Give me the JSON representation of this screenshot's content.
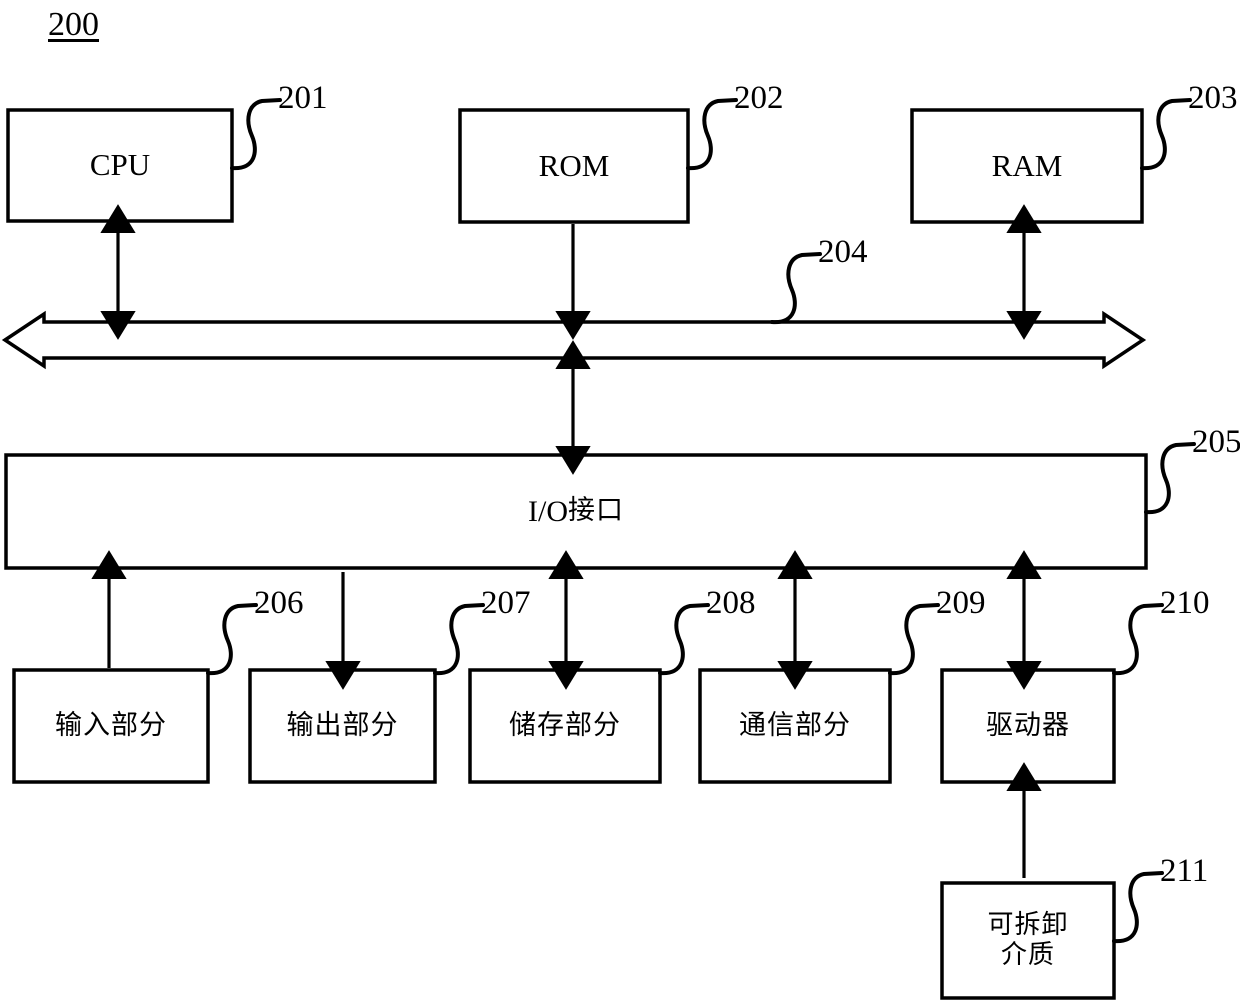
{
  "figure": {
    "number": "200",
    "blocks": [
      {
        "id": "cpu",
        "label": "CPU",
        "ref": "201"
      },
      {
        "id": "rom",
        "label": "ROM",
        "ref": "202"
      },
      {
        "id": "ram",
        "label": "RAM",
        "ref": "203"
      },
      {
        "id": "bus",
        "label": "",
        "ref": "204"
      },
      {
        "id": "io-interface",
        "label": "I/O接口",
        "ref": "205"
      },
      {
        "id": "input-part",
        "label": "输入部分",
        "ref": "206"
      },
      {
        "id": "output-part",
        "label": "输出部分",
        "ref": "207"
      },
      {
        "id": "storage-part",
        "label": "储存部分",
        "ref": "208"
      },
      {
        "id": "comm-part",
        "label": "通信部分",
        "ref": "209"
      },
      {
        "id": "driver",
        "label": "驱动器",
        "ref": "210"
      },
      {
        "id": "removable",
        "label": "可拆卸\n介质",
        "ref": "211"
      }
    ],
    "io_label_latin": "I/O",
    "io_label_cjk": "接口",
    "connections": [
      {
        "from": "cpu",
        "to": "bus",
        "direction": "bidirectional"
      },
      {
        "from": "rom",
        "to": "bus",
        "direction": "down"
      },
      {
        "from": "ram",
        "to": "bus",
        "direction": "bidirectional"
      },
      {
        "from": "bus",
        "to": "io-interface",
        "direction": "bidirectional"
      },
      {
        "from": "io-interface",
        "to": "input-part",
        "direction": "up"
      },
      {
        "from": "io-interface",
        "to": "output-part",
        "direction": "down"
      },
      {
        "from": "io-interface",
        "to": "storage-part",
        "direction": "bidirectional"
      },
      {
        "from": "io-interface",
        "to": "comm-part",
        "direction": "bidirectional"
      },
      {
        "from": "io-interface",
        "to": "driver",
        "direction": "bidirectional"
      },
      {
        "from": "removable",
        "to": "driver",
        "direction": "up"
      }
    ],
    "colors": {
      "stroke": "#000000",
      "fill": "#ffffff",
      "background": "#ffffff"
    }
  }
}
